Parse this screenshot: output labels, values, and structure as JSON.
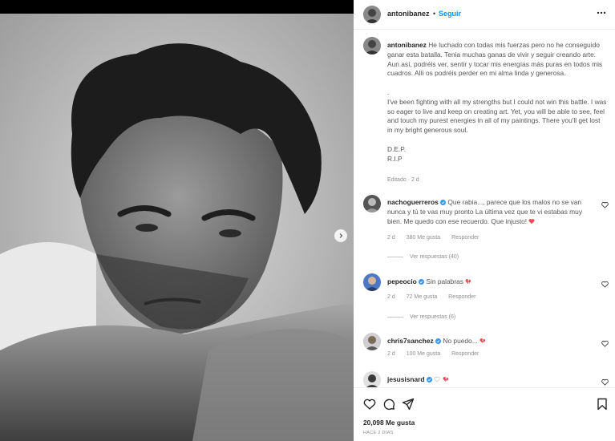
{
  "post": {
    "username": "antonibanez",
    "separator": "•",
    "follow_label": "Seguir"
  },
  "caption": {
    "username": "antonibanez",
    "spanish": "He luchado con todas mis fuerzas pero no he conseguido ganar esta batalla. Tenia muchas ganas de vivir y seguir creando arte. Aun así, podréis ver, sentir y tocar mis energías más puras en todos mis cuadros. Allí os podréis perder en mi alma linda y generosa.",
    "dot": ".",
    "english": "I've been fighting with all my strengths but I could not win this battle. I was so eager to live and keep on creating art. Yet, you will be able to see, feel and touch my purest energies in all of my paintings. There you'll get lost in my bright generous soul.",
    "dep": "D.E.P.",
    "rip": "R.I.P",
    "meta": "Editado · 2 d"
  },
  "comments": [
    {
      "username": "nachoguerreros",
      "text": "Que rabia..., parece que los malos no se van nunca y tú te vas muy pronto La última vez que te vi estabas muy bien. Me quedo con ese recuerdo. Que injusto!",
      "emoji": "heart",
      "age": "2 d",
      "likes": "380 Me gusta",
      "reply_label": "Responder",
      "replies": "Ver respuestas (40)"
    },
    {
      "username": "pepeocio",
      "text": "Sin palabras",
      "emoji": "broken-heart",
      "age": "2 d",
      "likes": "72 Me gusta",
      "reply_label": "Responder",
      "replies": "Ver respuestas (6)"
    },
    {
      "username": "chris7sanchez",
      "text": "No puedo...",
      "emoji": "broken-heart",
      "age": "2 d",
      "likes": "100 Me gusta",
      "reply_label": "Responder"
    },
    {
      "username": "jesusisnard",
      "text": "",
      "emoji": "white-heart broken-heart"
    }
  ],
  "footer": {
    "likes": "20,098 Me gusta",
    "posted": "HACE 2 DÍAS"
  },
  "colors": {
    "link_blue": "#0095f6",
    "verified_blue": "#3897f0",
    "heart_red": "#ed4956",
    "text": "#262626",
    "muted": "#8e8e8e"
  },
  "icons": [
    "more-options-icon",
    "verified-icon",
    "heart-icon",
    "comment-icon",
    "share-icon",
    "save-icon",
    "chevron-right-icon"
  ]
}
